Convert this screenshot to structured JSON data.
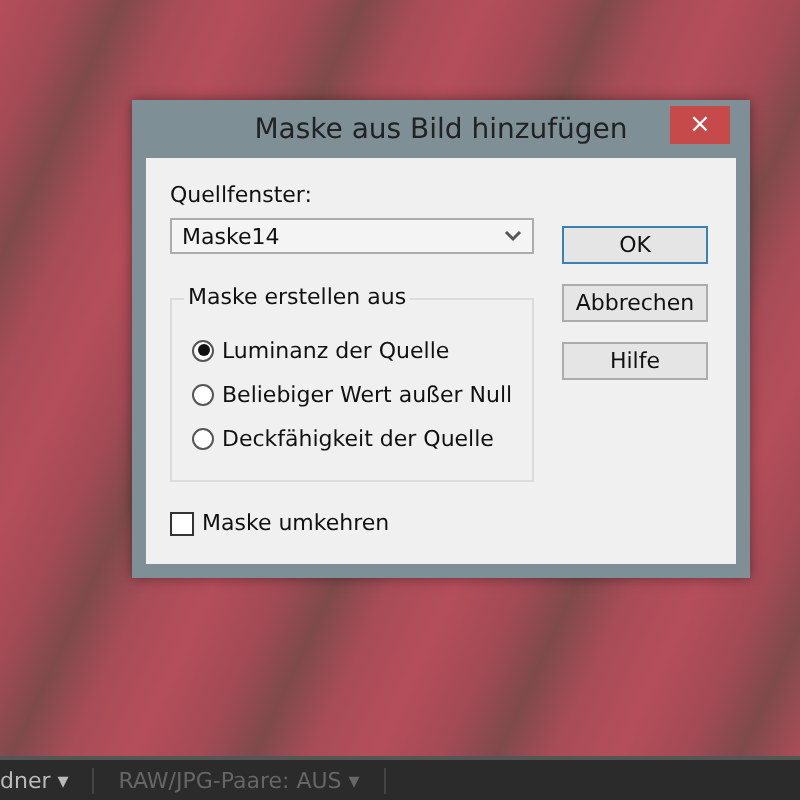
{
  "dialog": {
    "title": "Maske aus Bild hinzufügen",
    "close": "×",
    "source_label": "Quellfenster:",
    "source_value": "Maske14",
    "group": {
      "title": "Maske erstellen aus",
      "options": [
        {
          "label": "Luminanz der Quelle",
          "selected": true
        },
        {
          "label": "Beliebiger Wert außer Null",
          "selected": false
        },
        {
          "label": "Deckfähigkeit der Quelle",
          "selected": false
        }
      ]
    },
    "invert": {
      "label": "Maske umkehren",
      "checked": false
    },
    "buttons": [
      {
        "label": "OK",
        "default": true
      },
      {
        "label": "Abbrechen",
        "default": false
      },
      {
        "label": "Hilfe",
        "default": false
      }
    ]
  },
  "status_bar": [
    {
      "label": "dner",
      "caret": "▾"
    },
    {
      "label": "RAW/JPG-Paare: AUS",
      "caret": "▾"
    }
  ]
}
